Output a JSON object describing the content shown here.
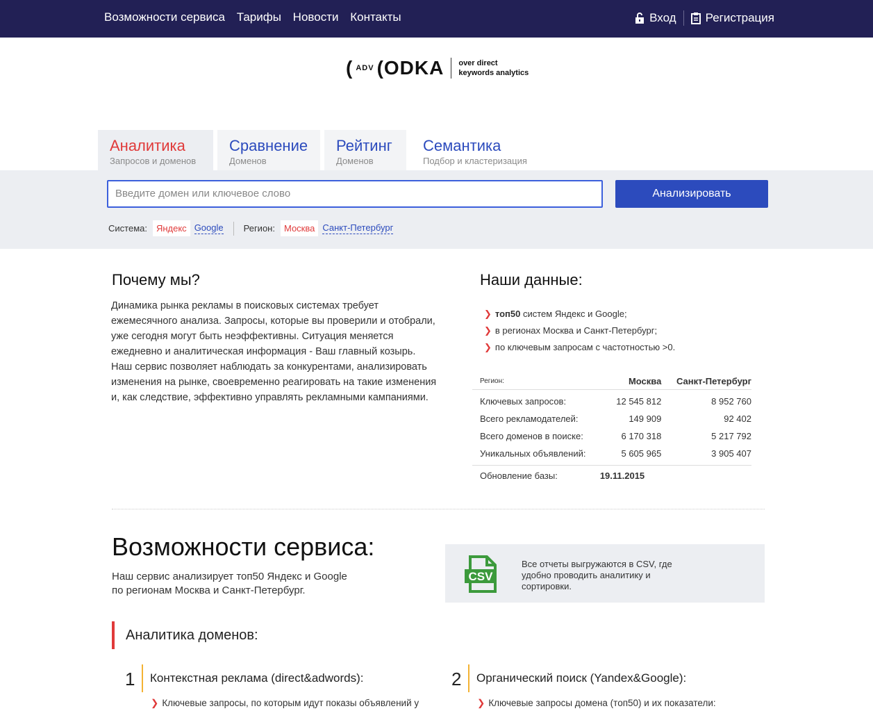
{
  "topnav": {
    "items": [
      "Возможности сервиса",
      "Тарифы",
      "Новости",
      "Контакты"
    ],
    "login": "Вход",
    "register": "Регистрация"
  },
  "logo": {
    "adv": "ADV",
    "name": "ODKA",
    "tagline1": "over direct",
    "tagline2": "keywords analytics"
  },
  "tabs": [
    {
      "title": "Аналитика",
      "sub": "Запросов и доменов"
    },
    {
      "title": "Сравнение",
      "sub": "Доменов"
    },
    {
      "title": "Рейтинг",
      "sub": "Доменов"
    },
    {
      "title": "Семантика",
      "sub": "Подбор и кластеризация запросов"
    }
  ],
  "search": {
    "placeholder": "Введите домен или ключевое слово",
    "button": "Анализировать"
  },
  "filters": {
    "system_label": "Система:",
    "system_active": "Яндекс",
    "system_other": "Google",
    "region_label": "Регион:",
    "region_active": "Москва",
    "region_other": "Санкт-Петербург"
  },
  "why": {
    "title": "Почему мы?",
    "text": "Динамика рынка рекламы в поисковых системах требует ежемесячного анализа. Запросы, которые вы проверили и отобрали, уже сегодня могут быть неэффективны. Ситуация меняется ежедневно и аналитическая информация - Ваш главный козырь. Наш сервис позволяет наблюдать за конкурентами, анализировать изменения на рынке, своевременно реагировать на такие изменения и, как следствие, эффективно управлять рекламными кампаниями."
  },
  "ours": {
    "title": "Наши данные:",
    "b1_bold": "топ50",
    "b1_rest": " систем Яндекс и Google;",
    "b2": "в регионах Москва и Санкт-Петербург;",
    "b3": "по ключевым запросам с частотностью >0."
  },
  "stats": {
    "region_label": "Регион:",
    "col1": "Москва",
    "col2": "Санкт-Петербург",
    "rows": [
      {
        "label": "Ключевых запросов:",
        "msk": "12 545 812",
        "spb": "8 952 760"
      },
      {
        "label": "Всего рекламодателей:",
        "msk": "149 909",
        "spb": "92 402"
      },
      {
        "label": "Всего доменов в поиске:",
        "msk": "6 170 318",
        "spb": "5 217 792"
      },
      {
        "label": "Уникальных объявлений:",
        "msk": "5 605 965",
        "spb": "3 905 407"
      }
    ],
    "update_label": "Обновление базы:",
    "update_value": "19.11.2015"
  },
  "features": {
    "title": "Возможности сервиса:",
    "sub1": "Наш сервис анализирует топ50 Яндекс и Google",
    "sub2": "по регионам Москва и Санкт-Петербург.",
    "csv_icon_text": "CSV",
    "csv1": "Все отчеты выгружаются в CSV, где",
    "csv2": "удобно проводить аналитику и",
    "csv3": "сортировки.",
    "section": "Аналитика доменов:",
    "n1": "1",
    "item1": "Контекстная реклама (direct&adwords):",
    "sub_item1": "Ключевые запросы, по которым идут показы объявлений у",
    "n2": "2",
    "item2": "Органический поиск (Yandex&Google):",
    "sub_item2": "Ключевые запросы домена (топ50) и их показатели:"
  },
  "colors": {
    "header": "#222055",
    "accent": "#2c4bbd",
    "red": "#e03a3a",
    "band": "#eceef2"
  }
}
